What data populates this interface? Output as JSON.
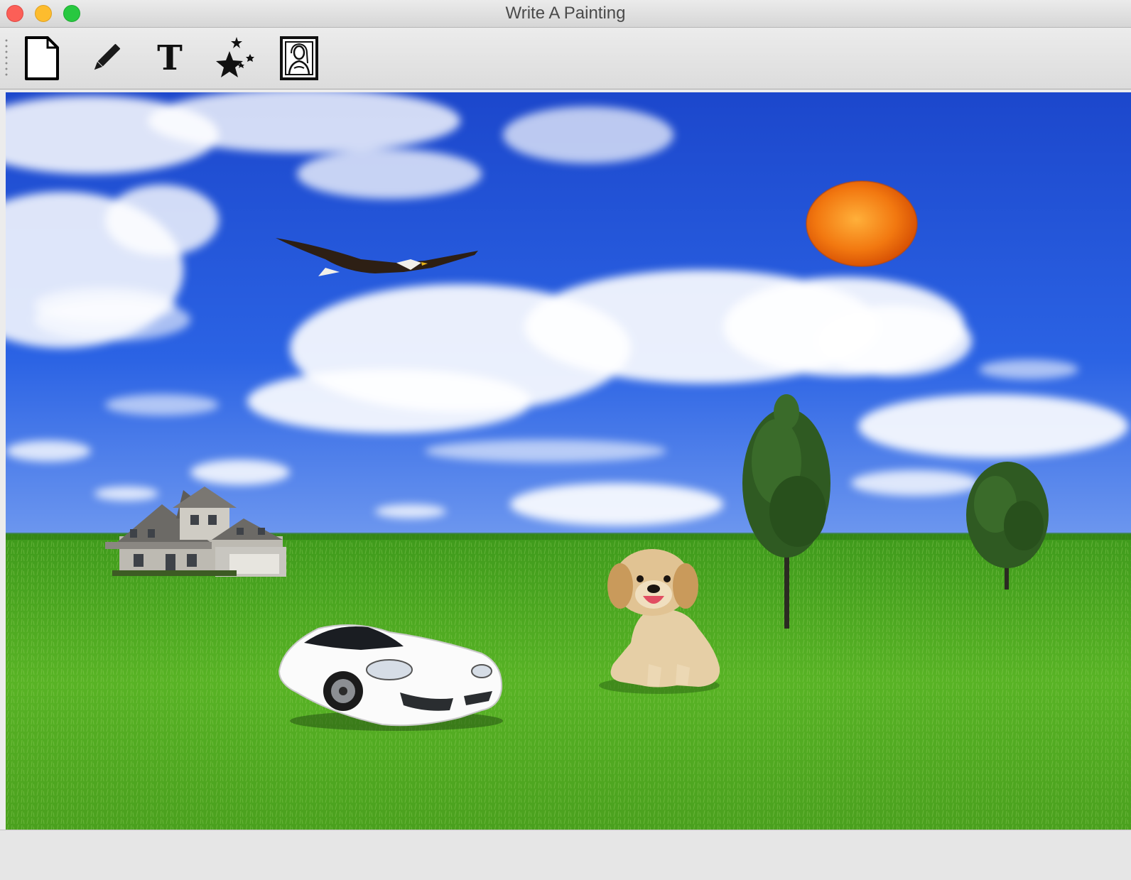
{
  "window": {
    "title": "Write A Painting"
  },
  "toolbar": {
    "tools": [
      {
        "icon": "new-document-icon"
      },
      {
        "icon": "pencil-icon"
      },
      {
        "icon": "text-icon",
        "glyph": "T"
      },
      {
        "icon": "magic-stars-icon"
      },
      {
        "icon": "portrait-frame-icon"
      }
    ]
  },
  "canvas": {
    "objects": [
      "eagle",
      "sun",
      "house",
      "car",
      "puppy",
      "tree",
      "tree"
    ]
  },
  "colors": {
    "sky_top": "#1e4fd6",
    "sky_bottom": "#5f8ff0",
    "grass": "#4aa41f",
    "sun": "#f07a10"
  }
}
